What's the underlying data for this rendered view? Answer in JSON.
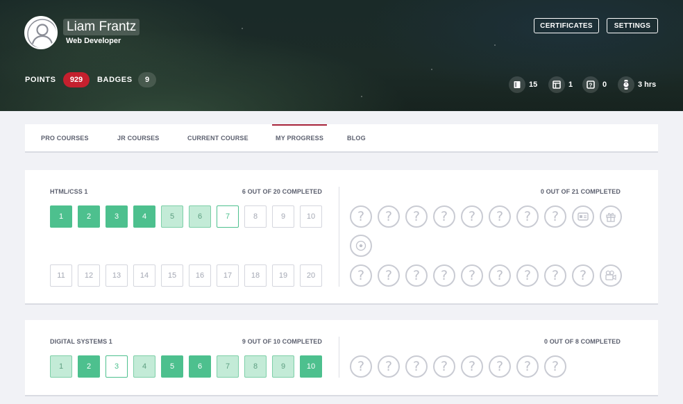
{
  "profile": {
    "name": "Liam Frantz",
    "title": "Web Developer",
    "points_label": "POINTS",
    "points": "929",
    "badges_label": "BADGES",
    "badges": "9"
  },
  "header_buttons": {
    "certificates": "CERTIFICATES",
    "settings": "SETTINGS"
  },
  "quick_stats": [
    {
      "icon": "book-icon",
      "value": "15"
    },
    {
      "icon": "layout-icon",
      "value": "1"
    },
    {
      "icon": "quiz-icon",
      "value": "0"
    },
    {
      "icon": "watch-icon",
      "value": "3 hrs"
    }
  ],
  "tabs": [
    {
      "label": "PRO COURSES",
      "active": false
    },
    {
      "label": "JR COURSES",
      "active": false
    },
    {
      "label": "CURRENT COURSE",
      "active": false
    },
    {
      "label": "MY PROGRESS",
      "active": true
    },
    {
      "label": "BLOG",
      "active": false
    }
  ],
  "courses": [
    {
      "title": "HTML/CSS 1",
      "completed_text": "6 OUT OF 20 COMPLETED",
      "challenges_text": "0 OUT OF 21 COMPLETED",
      "lessons": [
        {
          "n": "1",
          "status": "done"
        },
        {
          "n": "2",
          "status": "done"
        },
        {
          "n": "3",
          "status": "done"
        },
        {
          "n": "4",
          "status": "done"
        },
        {
          "n": "5",
          "status": "partial"
        },
        {
          "n": "6",
          "status": "partial"
        },
        {
          "n": "7",
          "status": "current"
        },
        {
          "n": "8",
          "status": "locked"
        },
        {
          "n": "9",
          "status": "locked"
        },
        {
          "n": "10",
          "status": "locked"
        },
        {
          "n": "11",
          "status": "locked"
        },
        {
          "n": "12",
          "status": "locked"
        },
        {
          "n": "13",
          "status": "locked"
        },
        {
          "n": "14",
          "status": "locked"
        },
        {
          "n": "15",
          "status": "locked"
        },
        {
          "n": "16",
          "status": "locked"
        },
        {
          "n": "17",
          "status": "locked"
        },
        {
          "n": "18",
          "status": "locked"
        },
        {
          "n": "19",
          "status": "locked"
        },
        {
          "n": "20",
          "status": "locked"
        }
      ],
      "challenges": [
        "question",
        "question",
        "question",
        "question",
        "question",
        "question",
        "question",
        "question",
        "id-card",
        "gift",
        "ball",
        "question",
        "question",
        "question",
        "question",
        "question",
        "question",
        "question",
        "question",
        "question",
        "video"
      ]
    },
    {
      "title": "DIGITAL SYSTEMS 1",
      "completed_text": "9 OUT OF 10 COMPLETED",
      "challenges_text": "0 OUT OF 8 COMPLETED",
      "lessons": [
        {
          "n": "1",
          "status": "partial"
        },
        {
          "n": "2",
          "status": "done"
        },
        {
          "n": "3",
          "status": "current"
        },
        {
          "n": "4",
          "status": "partial"
        },
        {
          "n": "5",
          "status": "done"
        },
        {
          "n": "6",
          "status": "done"
        },
        {
          "n": "7",
          "status": "partial"
        },
        {
          "n": "8",
          "status": "partial"
        },
        {
          "n": "9",
          "status": "partial"
        },
        {
          "n": "10",
          "status": "done"
        }
      ],
      "challenges": [
        "question",
        "question",
        "question",
        "question",
        "question",
        "question",
        "question",
        "question"
      ]
    }
  ],
  "colors": {
    "accent_red": "#c5202e",
    "tab_active": "#a8233a",
    "lesson_done": "#4dc08e",
    "lesson_partial": "#c3ebd7",
    "locked_border": "#d4d6dd"
  }
}
